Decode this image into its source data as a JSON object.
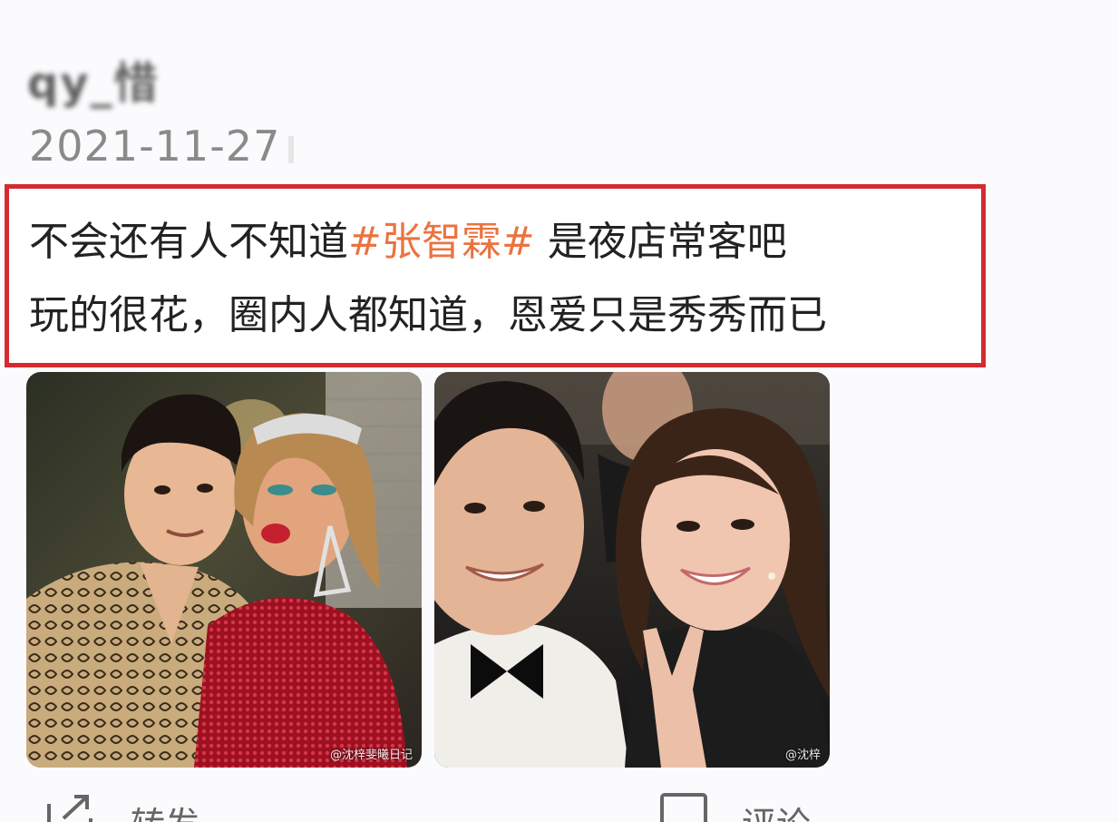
{
  "post": {
    "username": "qy_惜",
    "date": "2021-11-27",
    "line1_prefix": "不会还有人不知道",
    "hashtag": "#张智霖#",
    "line1_suffix": " 是夜店常客吧",
    "line2": "玩的很花，圈内人都知道，恩爱只是秀秀而已",
    "highlight_color": "#d62a32",
    "hashtag_color": "#eb7340"
  },
  "images": [
    {
      "alt": "photo-couple-party",
      "watermark": "@沈梓斐曦日记"
    },
    {
      "alt": "photo-couple-selfie",
      "watermark": "@沈梓"
    }
  ],
  "actions": {
    "repost_label": "转发",
    "comment_label": "评论"
  },
  "icons": {
    "repost": "repost-icon",
    "comment": "comment-icon"
  }
}
